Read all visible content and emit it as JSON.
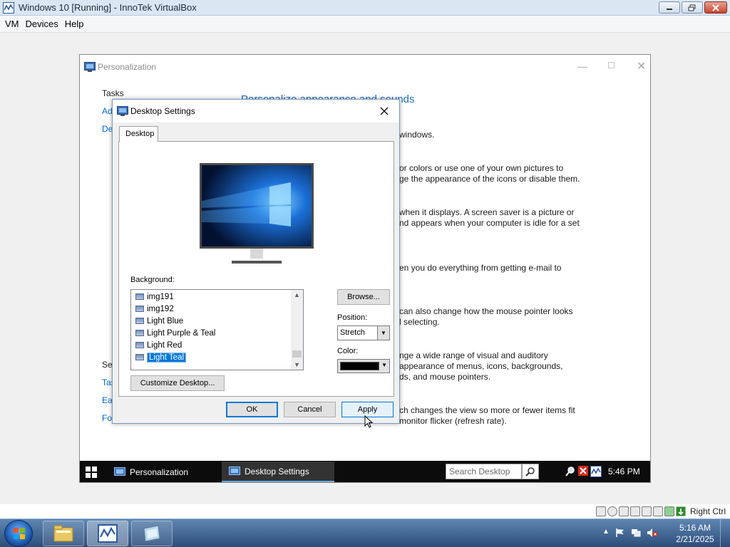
{
  "host": {
    "title": "Windows 10 [Running] - InnoTek VirtualBox",
    "menu": [
      "VM",
      "Devices",
      "Help"
    ],
    "status_right_ctrl": "Right Ctrl"
  },
  "personalization": {
    "title": "Personalization",
    "tasks_heading": "Tasks",
    "left_links": [
      "Ad",
      "De"
    ],
    "see_also_links": [
      "See",
      "Tas",
      "Eas",
      "Fo"
    ],
    "main_heading": "Personalize appearance and sounds",
    "text_lines": [
      "windows.",
      "or colors or use one of your own pictures to",
      "ge the appearance of the icons or disable them.",
      "when it displays. A screen saver is a picture or",
      "nd appears when your computer is idle for a set",
      "en you do everything from getting e-mail to",
      "can also change how the mouse pointer looks",
      "l selecting.",
      "nge a wide range of visual and auditory",
      "appearance of menus, icons, backgrounds,",
      "ds, and mouse pointers.",
      "ch changes the view so more or fewer items fit",
      "monitor flicker (refresh rate)."
    ]
  },
  "dialog": {
    "title": "Desktop Settings",
    "tab": "Desktop",
    "background_label": "Background:",
    "background_items": [
      "img191",
      "img192",
      "Light Blue",
      "Light Purple & Teal",
      "Light Red",
      "Light Teal"
    ],
    "selected_item": "Light Teal",
    "browse_label": "Browse...",
    "position_label": "Position:",
    "position_value": "Stretch",
    "color_label": "Color:",
    "color_value": "#000000",
    "customize_label": "Customize Desktop...",
    "ok_label": "OK",
    "cancel_label": "Cancel",
    "apply_label": "Apply"
  },
  "guest_taskbar": {
    "tasks": [
      "Personalization",
      "Desktop Settings"
    ],
    "active_task": "Desktop Settings",
    "search_placeholder": "Search Desktop",
    "clock": "5:46 PM"
  },
  "win7_taskbar": {
    "time": "5:16 AM",
    "date": "2/21/2025"
  }
}
